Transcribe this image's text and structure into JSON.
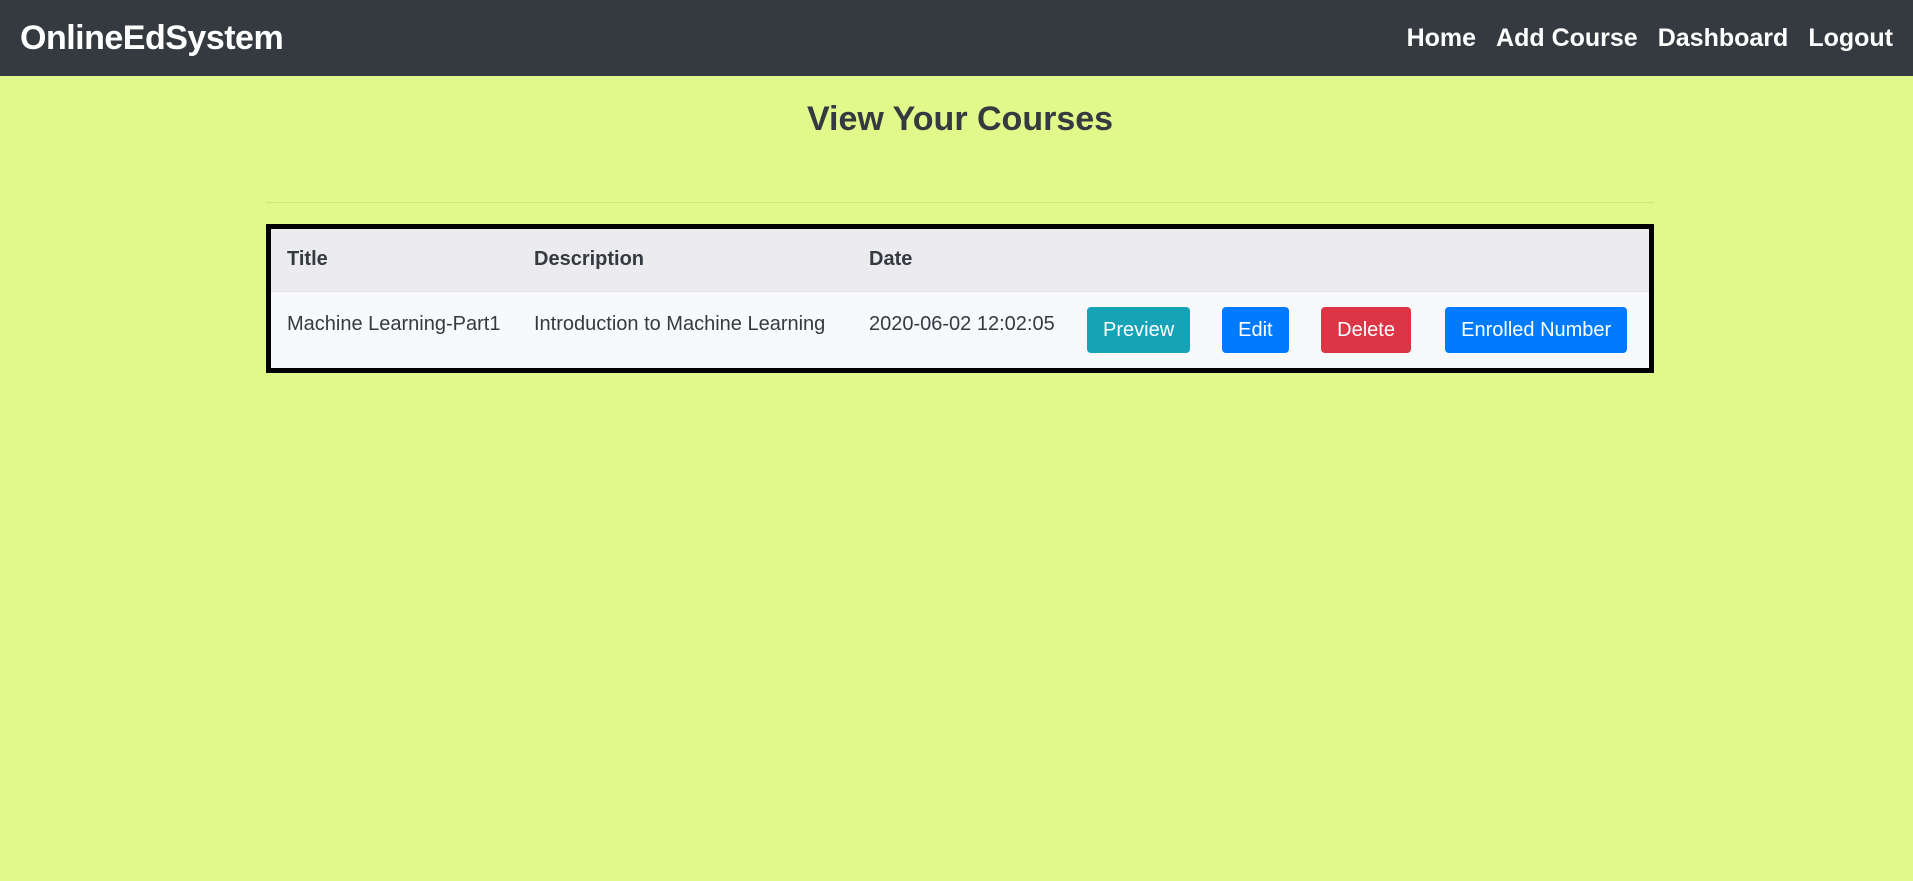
{
  "navbar": {
    "brand": "OnlineEdSystem",
    "links": [
      "Home",
      "Add Course",
      "Dashboard",
      "Logout"
    ]
  },
  "page": {
    "title": "View Your Courses"
  },
  "table": {
    "headers": [
      "Title",
      "Description",
      "Date"
    ],
    "rows": [
      {
        "title": "Machine Learning-Part1",
        "description": "Introduction to Machine Learning",
        "date": "2020-06-02 12:02:05",
        "actions": {
          "preview": "Preview",
          "edit": "Edit",
          "delete": "Delete",
          "enrolled": "Enrolled Number"
        }
      }
    ]
  },
  "colors": {
    "background": "#dff98b",
    "navbar": "#343a40",
    "preview": "#17a2b8",
    "primary": "#007bff",
    "danger": "#dc3545"
  }
}
